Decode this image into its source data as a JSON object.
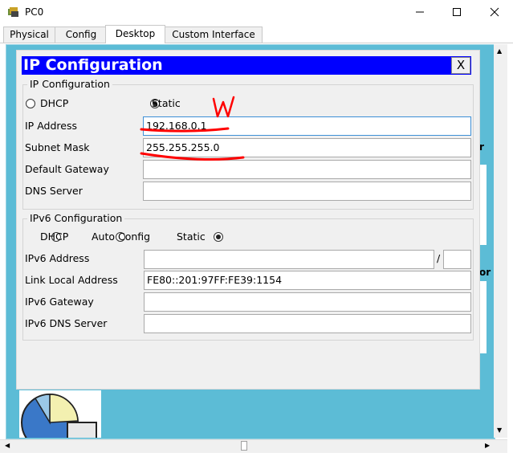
{
  "window": {
    "title": "PC0"
  },
  "tabs": [
    {
      "label": "Physical"
    },
    {
      "label": "Config"
    },
    {
      "label": "Desktop"
    },
    {
      "label": "Custom Interface"
    }
  ],
  "active_tab": "Desktop",
  "dialog": {
    "title": "IP Configuration",
    "close_label": "X",
    "ipv4": {
      "legend": "IP Configuration",
      "dhcp_label": "DHCP",
      "static_label": "Static",
      "mode": "static",
      "ip_address_label": "IP Address",
      "ip_address": "192.168.0.1",
      "subnet_mask_label": "Subnet Mask",
      "subnet_mask": "255.255.255.0",
      "default_gateway_label": "Default Gateway",
      "default_gateway": "",
      "dns_server_label": "DNS Server",
      "dns_server": ""
    },
    "ipv6": {
      "legend": "IPv6 Configuration",
      "dhcp_label": "DHCP",
      "auto_label": "Auto Config",
      "static_label": "Static",
      "mode": "static",
      "address_label": "IPv6 Address",
      "address": "",
      "prefix_separator": "/",
      "prefix": "",
      "link_local_label": "Link Local Address",
      "link_local": "FE80::201:97FF:FE39:1154",
      "gateway_label": "IPv6 Gateway",
      "gateway": "",
      "dns_label": "IPv6 DNS Server",
      "dns": ""
    }
  },
  "annotation": {
    "text": "W",
    "color": "#ff0000"
  },
  "background": {
    "partial_text_1": "r",
    "partial_text_2": "or"
  },
  "colors": {
    "title_bar": "#0000ff",
    "desktop": "#5cbcd6",
    "dialog_bg": "#f0f0f0"
  }
}
